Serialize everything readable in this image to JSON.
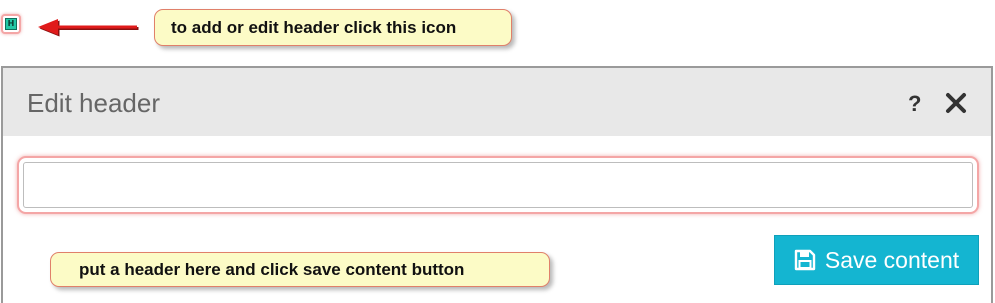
{
  "annotations": {
    "icon_callout": "to add or edit header click this icon",
    "input_callout": "put a header here and click save content button"
  },
  "header_icon": {
    "letter": "H",
    "icon": "header-h-icon",
    "color": "#24c7a5"
  },
  "modal": {
    "title": "Edit header",
    "help_icon": "?",
    "close_icon": "close-icon",
    "input": {
      "value": "",
      "placeholder": ""
    },
    "save_button": {
      "label": "Save content",
      "icon": "floppy-disk-icon",
      "color": "#14b5d1"
    }
  },
  "colors": {
    "arrow": "#e01b1b",
    "callout_bg": "#fcfbc6",
    "highlight": "#f4a6a6"
  }
}
